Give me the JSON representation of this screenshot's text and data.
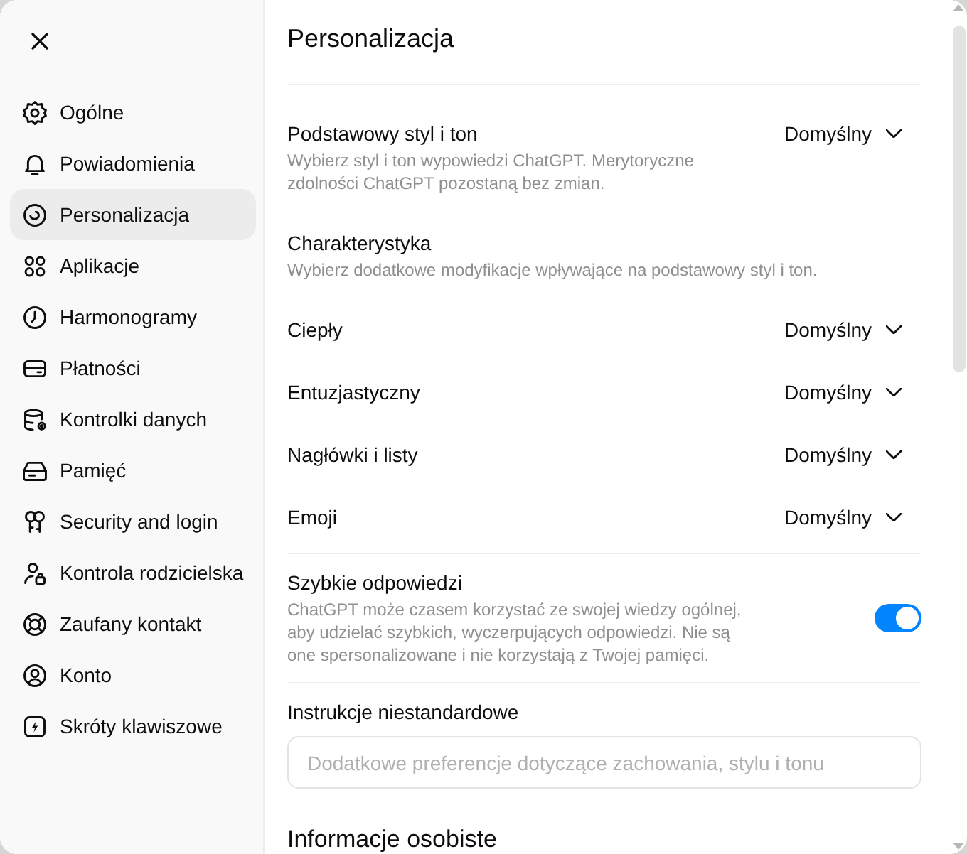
{
  "sidebar": {
    "items": [
      {
        "label": "Ogólne",
        "selected": false
      },
      {
        "label": "Powiadomienia",
        "selected": false
      },
      {
        "label": "Personalizacja",
        "selected": true
      },
      {
        "label": "Aplikacje",
        "selected": false
      },
      {
        "label": "Harmonogramy",
        "selected": false
      },
      {
        "label": "Płatności",
        "selected": false
      },
      {
        "label": "Kontrolki danych",
        "selected": false
      },
      {
        "label": "Pamięć",
        "selected": false
      },
      {
        "label": "Security and login",
        "selected": false
      },
      {
        "label": "Kontrola rodzicielska",
        "selected": false
      },
      {
        "label": "Zaufany kontakt",
        "selected": false
      },
      {
        "label": "Konto",
        "selected": false
      },
      {
        "label": "Skróty klawiszowe",
        "selected": false
      }
    ]
  },
  "settings": {
    "title": "Personalizacja",
    "groups": [
      {
        "rows": [
          {
            "kind": "select",
            "label": "Podstawowy styl i ton",
            "description": "Wybierz styl i ton wypowiedzi ChatGPT. Merytoryczne zdolności ChatGPT pozostaną bez zmian.",
            "value": "Domyślny"
          },
          {
            "kind": "info",
            "label": "Charakterystyka",
            "description": "Wybierz dodatkowe modyfikacje wpływające na podstawowy styl i ton."
          },
          {
            "kind": "select",
            "label": "Ciepły",
            "value": "Domyślny"
          },
          {
            "kind": "select",
            "label": "Entuzjastyczny",
            "value": "Domyślny"
          },
          {
            "kind": "select",
            "label": "Nagłówki i listy",
            "value": "Domyślny"
          },
          {
            "kind": "select",
            "label": "Emoji",
            "value": "Domyślny"
          }
        ]
      },
      {
        "rows": [
          {
            "kind": "toggle",
            "label": "Szybkie odpowiedzi",
            "description": "ChatGPT może czasem korzystać ze swojej wiedzy ogólnej, aby udzielać szybkich, wyczerpujących odpowiedzi. Nie są one spersonalizowane i nie korzystają z Twojej pamięci.",
            "on": true
          }
        ]
      },
      {
        "rows": [
          {
            "kind": "field",
            "label": "Instrukcje niestandardowe",
            "placeholder": "Dodatkowe preferencje dotyczące zachowania, stylu i tonu"
          }
        ]
      }
    ],
    "next_section": {
      "title": "Informacje osobiste"
    }
  }
}
